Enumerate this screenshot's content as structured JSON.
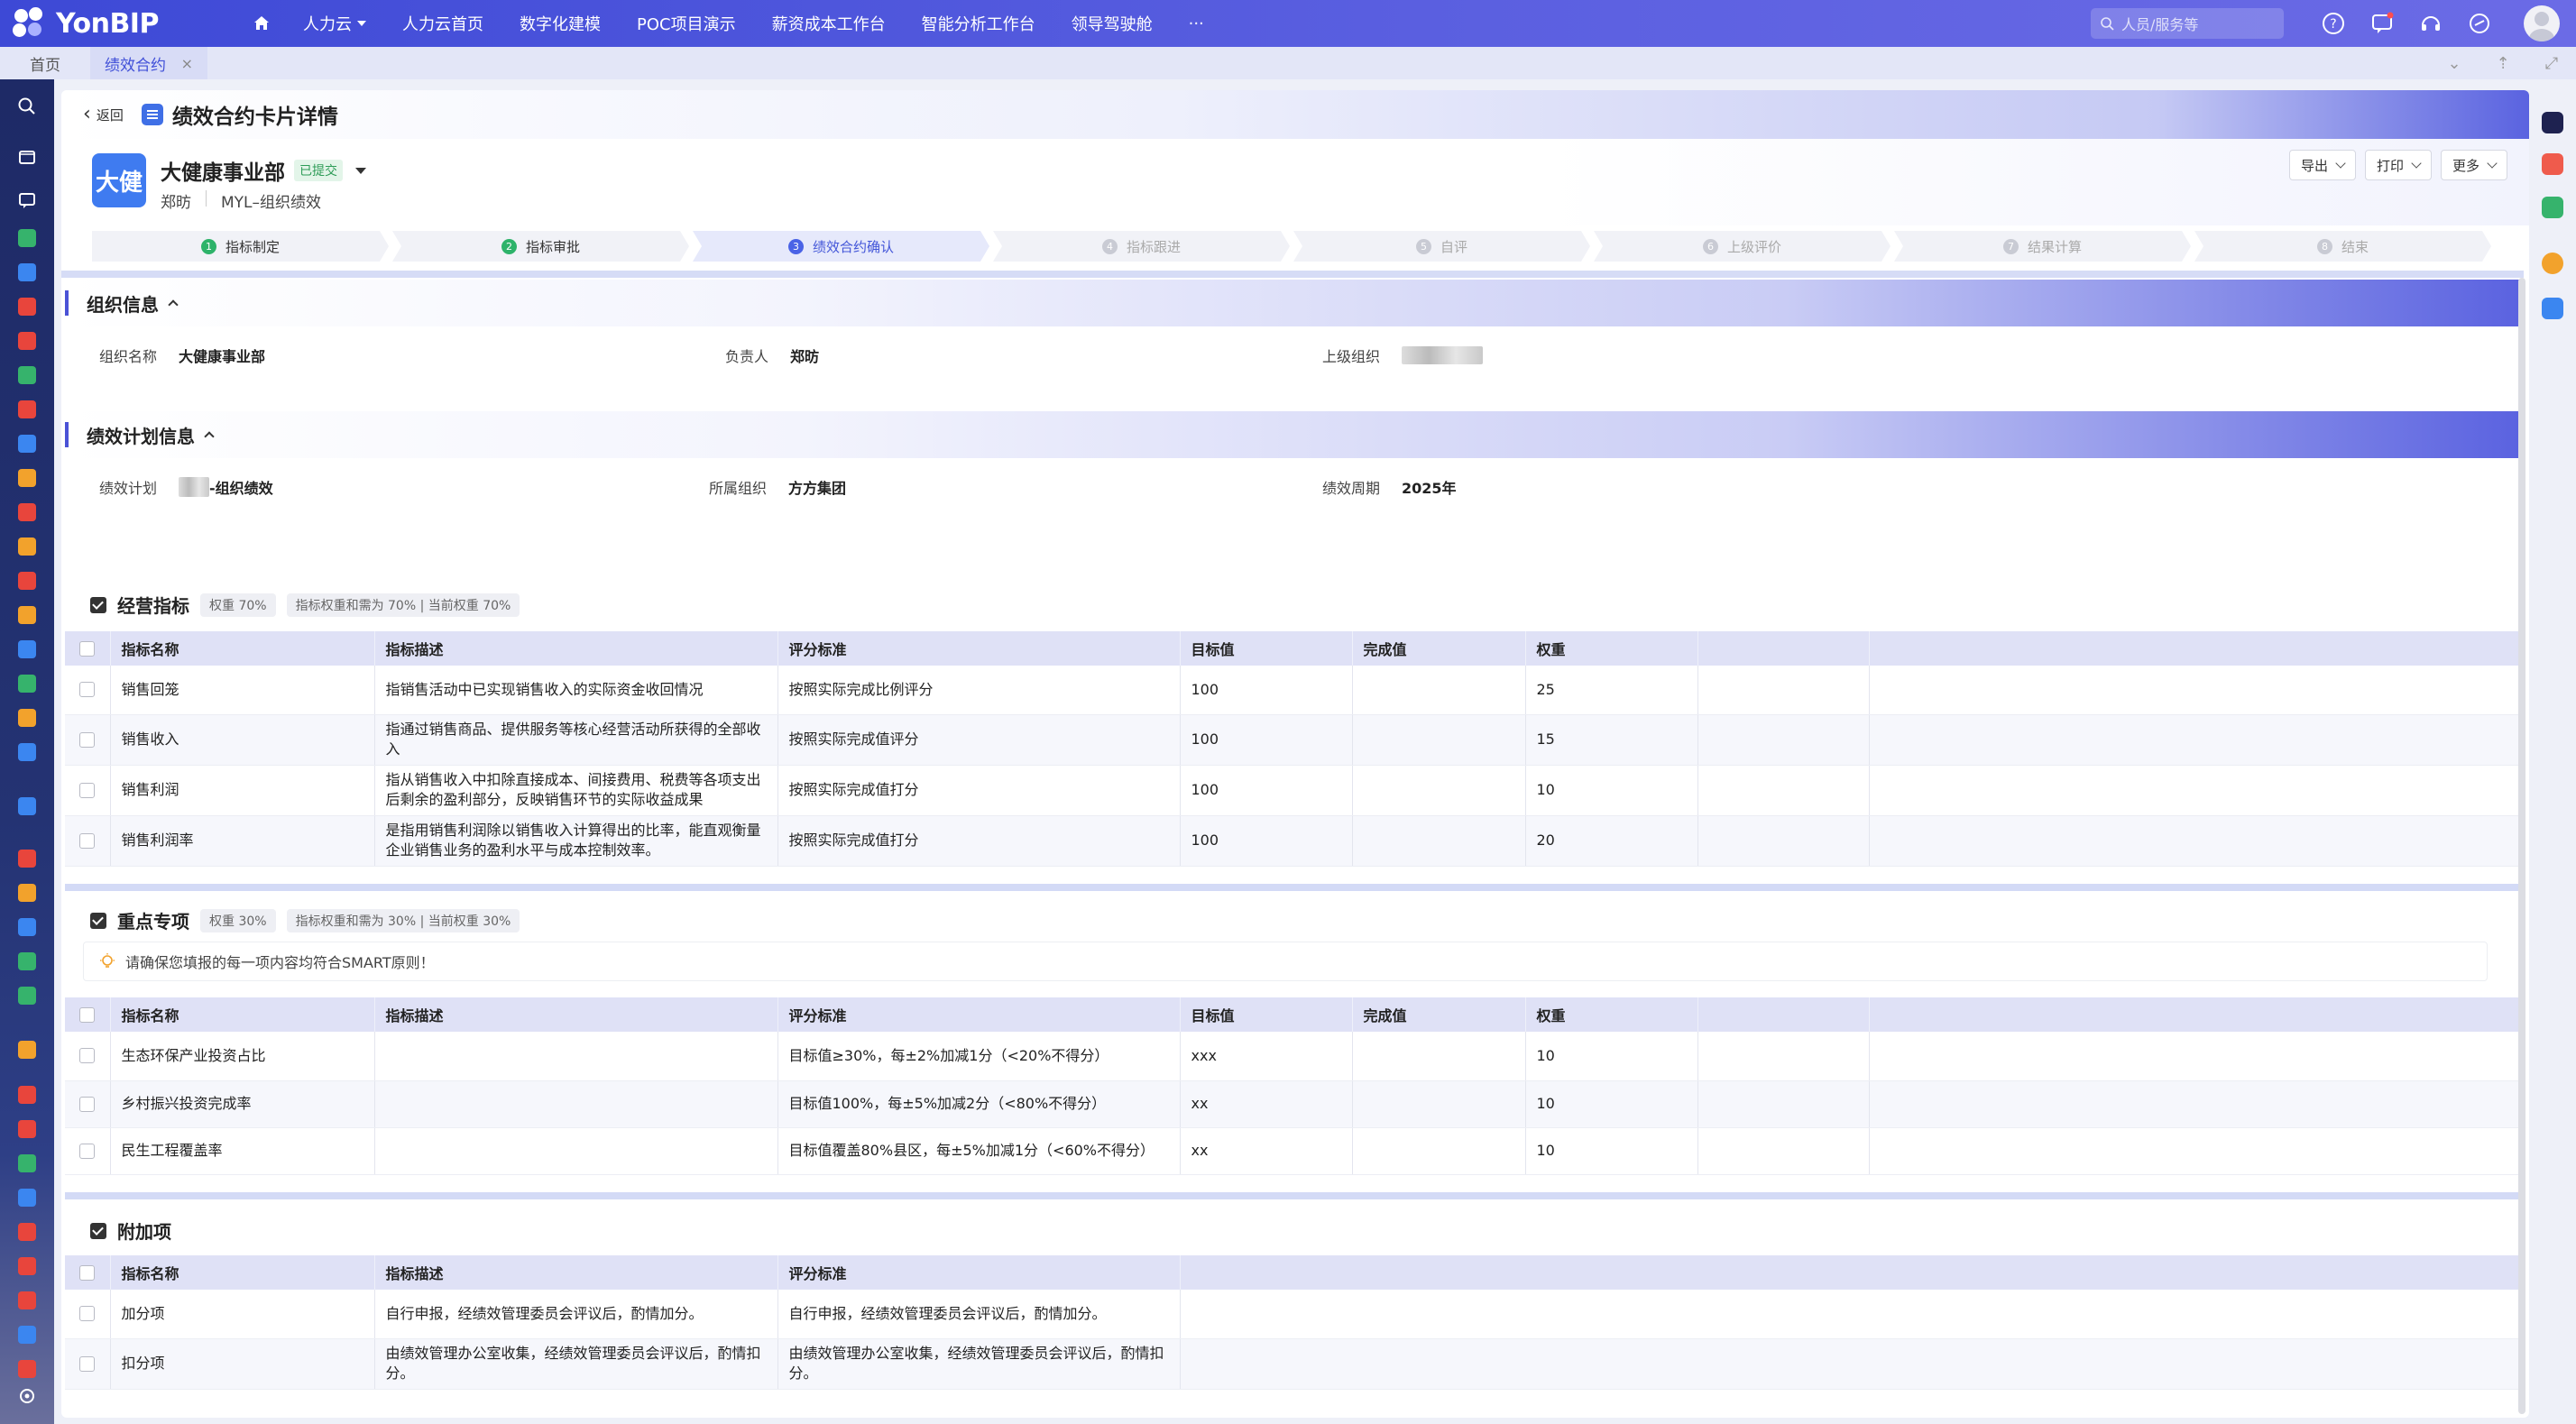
{
  "app": {
    "logo": "YonBIP",
    "nav": [
      {
        "label": "人力云",
        "dropdown": true
      },
      {
        "label": "人力云首页"
      },
      {
        "label": "数字化建模"
      },
      {
        "label": "POC项目演示"
      },
      {
        "label": "薪资成本工作台"
      },
      {
        "label": "智能分析工作台"
      },
      {
        "label": "领导驾驶舱"
      },
      {
        "label": "···"
      }
    ],
    "search_placeholder": "人员/服务等",
    "colors": {
      "topbar": "#3d49d6",
      "accent": "#4255d8",
      "done": "#2eb36a"
    }
  },
  "tabs": {
    "home": "首页",
    "active": "绩效合约",
    "close": "×"
  },
  "page": {
    "back": "返回",
    "title": "绩效合约卡片详情"
  },
  "header": {
    "badge": "大健",
    "org_name": "大健康事业部",
    "status": "已提交",
    "person": "郑昉",
    "plan": "MYL–组织绩效",
    "buttons": {
      "export": "导出",
      "print": "打印",
      "more": "更多"
    }
  },
  "steps": [
    {
      "num": "1",
      "label": "指标制定",
      "state": "done"
    },
    {
      "num": "2",
      "label": "指标审批",
      "state": "done"
    },
    {
      "num": "3",
      "label": "绩效合约确认",
      "state": "active"
    },
    {
      "num": "4",
      "label": "指标跟进",
      "state": "todo"
    },
    {
      "num": "5",
      "label": "自评",
      "state": "todo"
    },
    {
      "num": "6",
      "label": "上级评价",
      "state": "todo"
    },
    {
      "num": "7",
      "label": "结果计算",
      "state": "todo"
    },
    {
      "num": "8",
      "label": "结束",
      "state": "todo"
    }
  ],
  "org_info": {
    "title": "组织信息",
    "name_label": "组织名称",
    "name_value": "大健康事业部",
    "owner_label": "负责人",
    "owner_value": "郑昉",
    "parent_label": "上级组织"
  },
  "plan_info": {
    "title": "绩效计划信息",
    "plan_label": "绩效计划",
    "plan_value": "-组织绩效",
    "org_label": "所属组织",
    "org_value": "方方集团",
    "period_label": "绩效周期",
    "period_value": "2025年"
  },
  "groups": {
    "business": {
      "title": "经营指标",
      "pills": [
        "权重 70%",
        "指标权重和需为 70%  |  当前权重 70%"
      ],
      "headers": [
        "指标名称",
        "指标描述",
        "评分标准",
        "目标值",
        "完成值",
        "权重"
      ],
      "rows": [
        {
          "name": "销售回笼",
          "desc": "指销售活动中已实现销售收入的实际资金收回情况",
          "std": "按照实际完成比例评分",
          "target": "100",
          "done": "",
          "weight": "25"
        },
        {
          "name": "销售收入",
          "desc": "指通过销售商品、提供服务等核心经营活动所获得的全部收入",
          "std": "按照实际完成值评分",
          "target": "100",
          "done": "",
          "weight": "15"
        },
        {
          "name": "销售利润",
          "desc": "指从销售收入中扣除直接成本、间接费用、税费等各项支出后剩余的盈利部分，反映销售环节的实际收益成果",
          "std": "按照实际完成值打分",
          "target": "100",
          "done": "",
          "weight": "10"
        },
        {
          "name": "销售利润率",
          "desc": "是指用销售利润除以销售收入计算得出的比率，能直观衡量企业销售业务的盈利水平与成本控制效率。",
          "std": "按照实际完成值打分",
          "target": "100",
          "done": "",
          "weight": "20"
        }
      ]
    },
    "key": {
      "title": "重点专项",
      "pills": [
        "权重 30%",
        "指标权重和需为 30%  |  当前权重 30%"
      ],
      "tip": "请确保您填报的每一项内容均符合SMART原则！",
      "headers": [
        "指标名称",
        "指标描述",
        "评分标准",
        "目标值",
        "完成值",
        "权重"
      ],
      "rows": [
        {
          "name": "生态环保产业投资占比",
          "desc": "",
          "std": "目标值≥30%，每±2%加减1分（<20%不得分）",
          "target": "xxx",
          "done": "",
          "weight": "10"
        },
        {
          "name": "乡村振兴投资完成率",
          "desc": "",
          "std": "目标值100%，每±5%加减2分（<80%不得分）",
          "target": "xx",
          "done": "",
          "weight": "10"
        },
        {
          "name": "民生工程覆盖率",
          "desc": "",
          "std": "目标值覆盖80%县区，每±5%加减1分（<60%不得分）",
          "target": "xx",
          "done": "",
          "weight": "10"
        }
      ]
    },
    "extra": {
      "title": "附加项",
      "headers": [
        "指标名称",
        "指标描述",
        "评分标准"
      ],
      "rows": [
        {
          "name": "加分项",
          "desc": "自行申报，经绩效管理委员会评议后，酌情加分。",
          "std": "自行申报，经绩效管理委员会评议后，酌情加分。"
        },
        {
          "name": "扣分项",
          "desc": "由绩效管理办公室收集，经绩效管理委员会评议后，酌情扣分。",
          "std": "由绩效管理办公室收集，经绩效管理委员会评议后，酌情扣分。"
        }
      ]
    }
  }
}
